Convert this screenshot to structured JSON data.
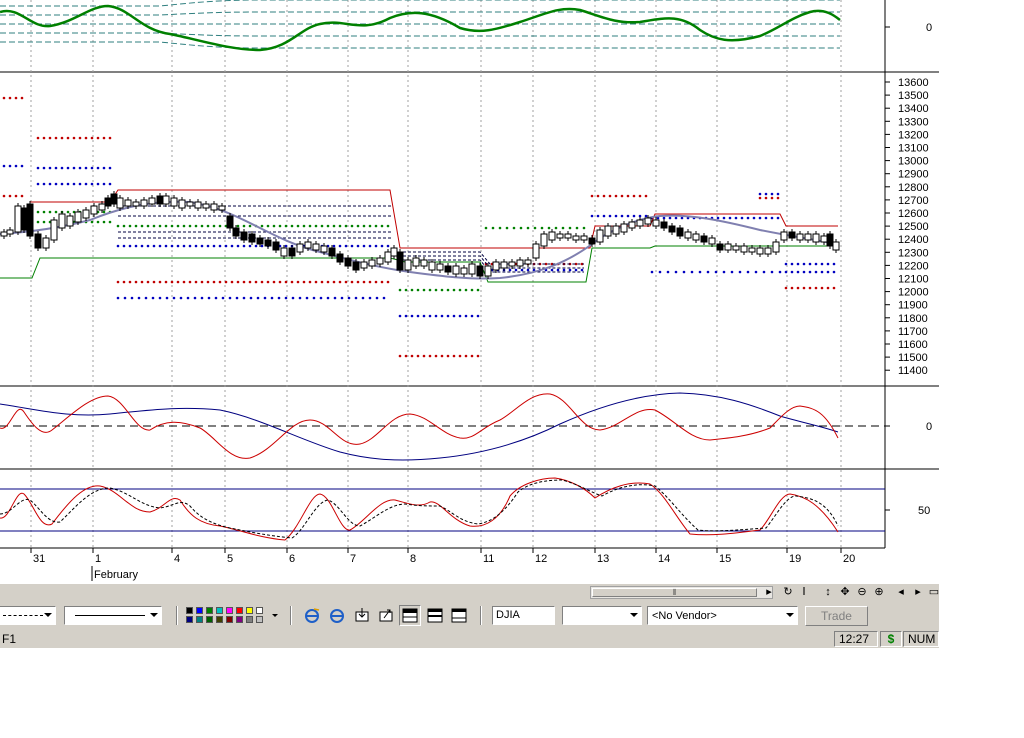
{
  "chart": {
    "axis_labels": {
      "top_zero": "0",
      "price": [
        "13600",
        "13500",
        "13400",
        "13300",
        "13200",
        "13100",
        "13000",
        "12900",
        "12800",
        "12700",
        "12600",
        "12500",
        "12400",
        "12300",
        "12200",
        "12100",
        "12000",
        "11900",
        "11800",
        "11700",
        "11600",
        "11500",
        "11400"
      ],
      "osc_zero": "0",
      "stoch_mid": "50"
    },
    "date_labels": [
      "31",
      "1",
      "4",
      "5",
      "6",
      "7",
      "8",
      "11",
      "12",
      "13",
      "14",
      "15",
      "19",
      "20"
    ],
    "month_label": "February",
    "colors": {
      "top_line": "#008000",
      "price_red": "#c00000",
      "price_green": "#008000",
      "price_blue": "#0000c0",
      "ma_line": "#8080b0",
      "osc_red": "#cc0000",
      "osc_navy": "#000080",
      "stoch_band": "#000080"
    }
  },
  "toolbar": {
    "palette": [
      "#000000",
      "#0000ff",
      "#008000",
      "#00c0c0",
      "#ff00ff",
      "#ff0000",
      "#ffff00",
      "#ffffff",
      "#000080",
      "#008080",
      "#006000",
      "#404000",
      "#800000",
      "#800080",
      "#808080",
      "#c0c0c0"
    ],
    "symbol": "DJIA",
    "vendor": "<No Vendor>",
    "trade_label": "Trade"
  },
  "status": {
    "left_text": "F1",
    "time": "12:27",
    "currency_icon": "$",
    "num": "NUM"
  }
}
